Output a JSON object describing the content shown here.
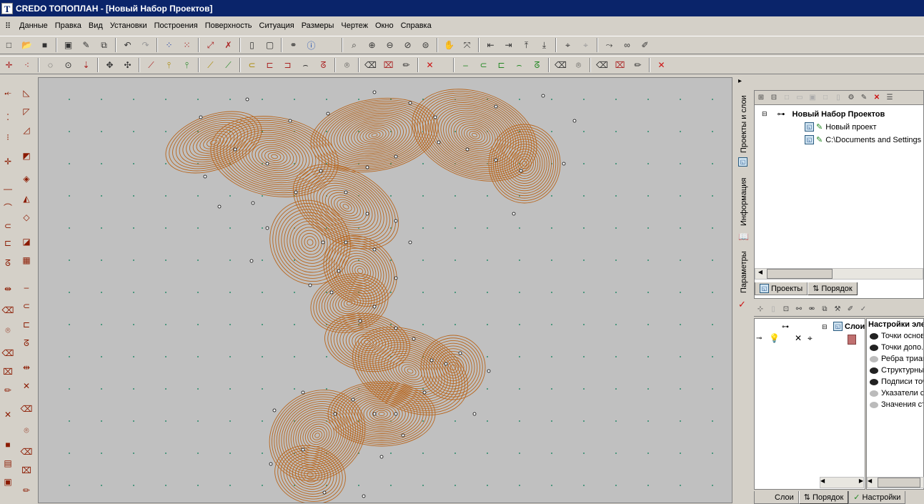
{
  "window": {
    "app_icon": "T",
    "title": "CREDO ТОПОПЛАН - [Новый Набор Проектов]"
  },
  "menu": [
    "Данные",
    "Правка",
    "Вид",
    "Установки",
    "Построения",
    "Поверхность",
    "Ситуация",
    "Размеры",
    "Чертеж",
    "Окно",
    "Справка"
  ],
  "side_tabs": {
    "projects": "Проекты и слои",
    "info": "Информация",
    "params": "Параметры"
  },
  "project_tree": {
    "root": "Новый Набор Проектов",
    "items": [
      "Новый проект",
      "C:\\Documents and Settings"
    ]
  },
  "panel1_tabs": {
    "projects": "Проекты",
    "order": "Порядок"
  },
  "layers": {
    "root": "Слои",
    "settings_title": "Настройки эле",
    "settings_items": [
      {
        "label": "Точки основ",
        "visible": true
      },
      {
        "label": "Точки допо.",
        "visible": true
      },
      {
        "label": "Ребра триан",
        "visible": false
      },
      {
        "label": "Структурны",
        "visible": true
      },
      {
        "label": "Подписи точ",
        "visible": true
      },
      {
        "label": "Указатели с",
        "visible": false
      },
      {
        "label": "Значения ст",
        "visible": false
      }
    ]
  },
  "panel2_tabs": {
    "layers": "Слои",
    "order": "Порядок",
    "settings": "Настройки"
  },
  "colors": {
    "titlebar": "#0a246a",
    "contour": "#b8651c",
    "canvas": "#c0c0c0",
    "grid_dot": "#2a8a6a"
  }
}
